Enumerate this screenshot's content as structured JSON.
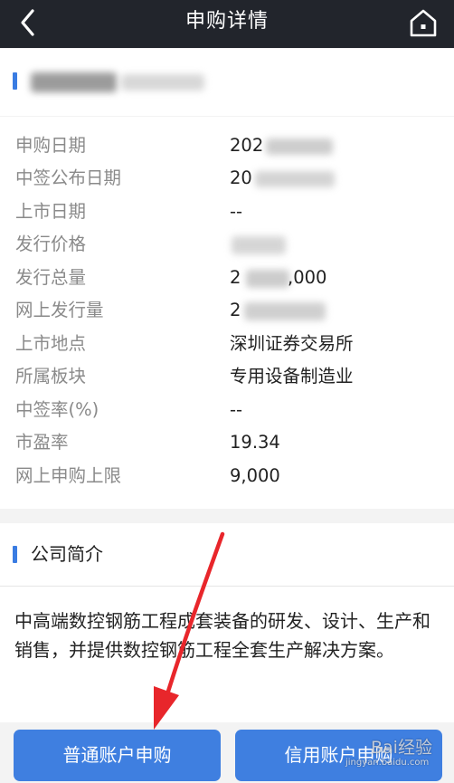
{
  "header": {
    "title": "申购详情"
  },
  "details": [
    {
      "label": "申购日期",
      "value": "202"
    },
    {
      "label": "中签公布日期",
      "value": "20"
    },
    {
      "label": "上市日期",
      "value": "--"
    },
    {
      "label": "发行价格",
      "value": ""
    },
    {
      "label": "发行总量",
      "value": "2"
    },
    {
      "label": "网上发行量",
      "value": "2"
    },
    {
      "label": "上市地点",
      "value": "深圳证券交易所"
    },
    {
      "label": "所属板块",
      "value": "专用设备制造业"
    },
    {
      "label": "中签率(%)",
      "value": "--"
    },
    {
      "label": "市盈率",
      "value": "19.34"
    },
    {
      "label": "网上申购上限",
      "value": "9,000"
    }
  ],
  "total_issue_tail": ",000",
  "intro": {
    "title": "公司简介",
    "text": "中高端数控钢筋工程成套装备的研发、设计、生产和销售，并提供数控钢筋工程全套生产解决方案。"
  },
  "buttons": {
    "normal_subscribe": "普通账户申购",
    "credit_subscribe": "信用账户申购"
  },
  "colors": {
    "topbar": "#22252c",
    "accent": "#3a7ce2",
    "button": "#3f7fe0",
    "arrow": "#e8262b"
  },
  "icons": {
    "back": "chevron-left-icon",
    "home": "home-icon"
  },
  "watermark": {
    "main": "Bai经验",
    "sub": "jingyan.baidu.com"
  }
}
